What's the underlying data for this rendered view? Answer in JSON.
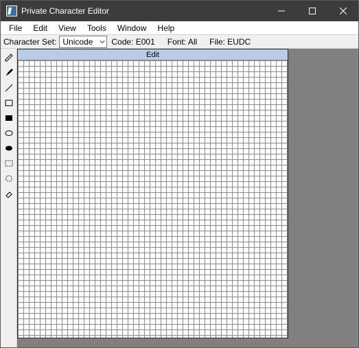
{
  "titlebar": {
    "title": "Private Character Editor"
  },
  "menu": {
    "items": [
      "File",
      "Edit",
      "View",
      "Tools",
      "Window",
      "Help"
    ]
  },
  "infobar": {
    "charset_label": "Character Set:",
    "charset_value": "Unicode",
    "code_label": "Code:",
    "code_value": "E001",
    "font_label": "Font:",
    "font_value": "All",
    "file_label": "File:",
    "file_value": "EUDC"
  },
  "canvas": {
    "title": "Edit"
  },
  "tools": [
    {
      "name": "pencil"
    },
    {
      "name": "brush"
    },
    {
      "name": "line"
    },
    {
      "name": "rectangle-outline"
    },
    {
      "name": "rectangle-filled"
    },
    {
      "name": "ellipse-outline"
    },
    {
      "name": "ellipse-filled"
    },
    {
      "name": "select-rectangle"
    },
    {
      "name": "select-freeform"
    },
    {
      "name": "eraser"
    }
  ]
}
